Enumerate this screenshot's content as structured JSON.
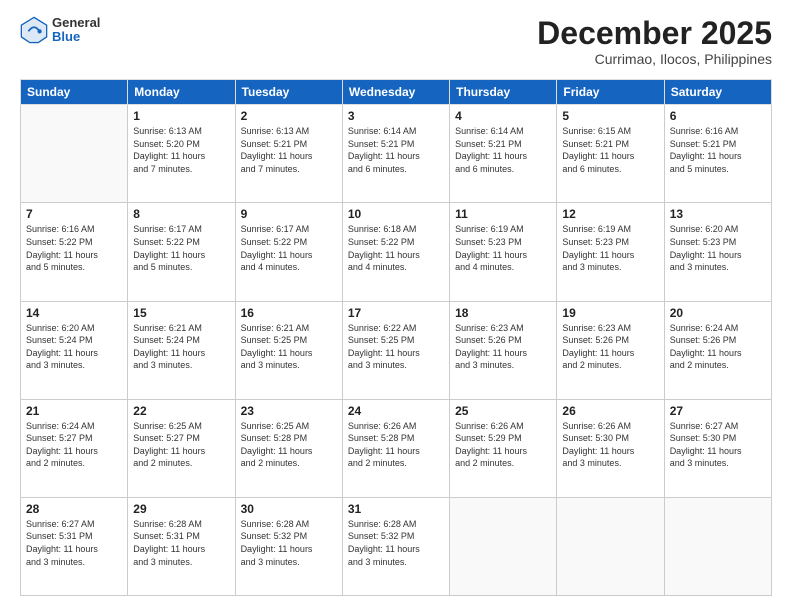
{
  "logo": {
    "general": "General",
    "blue": "Blue"
  },
  "header": {
    "month": "December 2025",
    "location": "Currimao, Ilocos, Philippines"
  },
  "weekdays": [
    "Sunday",
    "Monday",
    "Tuesday",
    "Wednesday",
    "Thursday",
    "Friday",
    "Saturday"
  ],
  "weeks": [
    [
      {
        "day": "",
        "info": ""
      },
      {
        "day": "1",
        "info": "Sunrise: 6:13 AM\nSunset: 5:20 PM\nDaylight: 11 hours\nand 7 minutes."
      },
      {
        "day": "2",
        "info": "Sunrise: 6:13 AM\nSunset: 5:21 PM\nDaylight: 11 hours\nand 7 minutes."
      },
      {
        "day": "3",
        "info": "Sunrise: 6:14 AM\nSunset: 5:21 PM\nDaylight: 11 hours\nand 6 minutes."
      },
      {
        "day": "4",
        "info": "Sunrise: 6:14 AM\nSunset: 5:21 PM\nDaylight: 11 hours\nand 6 minutes."
      },
      {
        "day": "5",
        "info": "Sunrise: 6:15 AM\nSunset: 5:21 PM\nDaylight: 11 hours\nand 6 minutes."
      },
      {
        "day": "6",
        "info": "Sunrise: 6:16 AM\nSunset: 5:21 PM\nDaylight: 11 hours\nand 5 minutes."
      }
    ],
    [
      {
        "day": "7",
        "info": "Sunrise: 6:16 AM\nSunset: 5:22 PM\nDaylight: 11 hours\nand 5 minutes."
      },
      {
        "day": "8",
        "info": "Sunrise: 6:17 AM\nSunset: 5:22 PM\nDaylight: 11 hours\nand 5 minutes."
      },
      {
        "day": "9",
        "info": "Sunrise: 6:17 AM\nSunset: 5:22 PM\nDaylight: 11 hours\nand 4 minutes."
      },
      {
        "day": "10",
        "info": "Sunrise: 6:18 AM\nSunset: 5:22 PM\nDaylight: 11 hours\nand 4 minutes."
      },
      {
        "day": "11",
        "info": "Sunrise: 6:19 AM\nSunset: 5:23 PM\nDaylight: 11 hours\nand 4 minutes."
      },
      {
        "day": "12",
        "info": "Sunrise: 6:19 AM\nSunset: 5:23 PM\nDaylight: 11 hours\nand 3 minutes."
      },
      {
        "day": "13",
        "info": "Sunrise: 6:20 AM\nSunset: 5:23 PM\nDaylight: 11 hours\nand 3 minutes."
      }
    ],
    [
      {
        "day": "14",
        "info": "Sunrise: 6:20 AM\nSunset: 5:24 PM\nDaylight: 11 hours\nand 3 minutes."
      },
      {
        "day": "15",
        "info": "Sunrise: 6:21 AM\nSunset: 5:24 PM\nDaylight: 11 hours\nand 3 minutes."
      },
      {
        "day": "16",
        "info": "Sunrise: 6:21 AM\nSunset: 5:25 PM\nDaylight: 11 hours\nand 3 minutes."
      },
      {
        "day": "17",
        "info": "Sunrise: 6:22 AM\nSunset: 5:25 PM\nDaylight: 11 hours\nand 3 minutes."
      },
      {
        "day": "18",
        "info": "Sunrise: 6:23 AM\nSunset: 5:26 PM\nDaylight: 11 hours\nand 3 minutes."
      },
      {
        "day": "19",
        "info": "Sunrise: 6:23 AM\nSunset: 5:26 PM\nDaylight: 11 hours\nand 2 minutes."
      },
      {
        "day": "20",
        "info": "Sunrise: 6:24 AM\nSunset: 5:26 PM\nDaylight: 11 hours\nand 2 minutes."
      }
    ],
    [
      {
        "day": "21",
        "info": "Sunrise: 6:24 AM\nSunset: 5:27 PM\nDaylight: 11 hours\nand 2 minutes."
      },
      {
        "day": "22",
        "info": "Sunrise: 6:25 AM\nSunset: 5:27 PM\nDaylight: 11 hours\nand 2 minutes."
      },
      {
        "day": "23",
        "info": "Sunrise: 6:25 AM\nSunset: 5:28 PM\nDaylight: 11 hours\nand 2 minutes."
      },
      {
        "day": "24",
        "info": "Sunrise: 6:26 AM\nSunset: 5:28 PM\nDaylight: 11 hours\nand 2 minutes."
      },
      {
        "day": "25",
        "info": "Sunrise: 6:26 AM\nSunset: 5:29 PM\nDaylight: 11 hours\nand 2 minutes."
      },
      {
        "day": "26",
        "info": "Sunrise: 6:26 AM\nSunset: 5:30 PM\nDaylight: 11 hours\nand 3 minutes."
      },
      {
        "day": "27",
        "info": "Sunrise: 6:27 AM\nSunset: 5:30 PM\nDaylight: 11 hours\nand 3 minutes."
      }
    ],
    [
      {
        "day": "28",
        "info": "Sunrise: 6:27 AM\nSunset: 5:31 PM\nDaylight: 11 hours\nand 3 minutes."
      },
      {
        "day": "29",
        "info": "Sunrise: 6:28 AM\nSunset: 5:31 PM\nDaylight: 11 hours\nand 3 minutes."
      },
      {
        "day": "30",
        "info": "Sunrise: 6:28 AM\nSunset: 5:32 PM\nDaylight: 11 hours\nand 3 minutes."
      },
      {
        "day": "31",
        "info": "Sunrise: 6:28 AM\nSunset: 5:32 PM\nDaylight: 11 hours\nand 3 minutes."
      },
      {
        "day": "",
        "info": ""
      },
      {
        "day": "",
        "info": ""
      },
      {
        "day": "",
        "info": ""
      }
    ]
  ]
}
